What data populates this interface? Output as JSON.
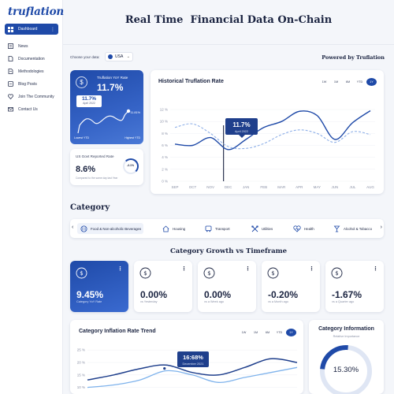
{
  "brand": {
    "logo": "truflation"
  },
  "sidebar": {
    "items": [
      {
        "label": "Dashboard",
        "icon": "dashboard-icon",
        "active": true
      },
      {
        "label": "News",
        "icon": "news-icon"
      },
      {
        "label": "Documentation",
        "icon": "document-icon"
      },
      {
        "label": "Methodologies",
        "icon": "methodology-icon"
      },
      {
        "label": "Blog Posts",
        "icon": "blog-icon"
      },
      {
        "label": "Join The Community",
        "icon": "community-icon"
      },
      {
        "label": "Contact Us",
        "icon": "mail-icon"
      }
    ]
  },
  "header": {
    "title": "Real Time  Financial Data On-Chain"
  },
  "controls": {
    "choose_label": "Choose your data:",
    "country": "USA",
    "powered_by": "Powered by Truflation"
  },
  "truflation_card": {
    "label": "Truflation YoY Rate",
    "value": "11.7%",
    "tooltip_value": "11.7%",
    "tooltip_date": "April 2022",
    "max_value": "11.81%",
    "lowest_label": "Lowest YTD",
    "highest_label": "Highest YTD"
  },
  "govt_card": {
    "label": "US Govt Reported Rate",
    "value": "8.6%",
    "sub": "Compared to the same day last Year",
    "ring_value": "-3.1%"
  },
  "historical": {
    "title": "Historical Truflation Rate",
    "ranges": [
      "1W",
      "1M",
      "6M",
      "YTD",
      "1Y"
    ],
    "active_range": "1Y",
    "tooltip_value": "11.7%",
    "tooltip_date": "April 2022"
  },
  "chart_data": [
    {
      "type": "line",
      "title": "Historical Truflation Rate",
      "x": [
        "SEP",
        "OCT",
        "NOV",
        "DEC",
        "JAN",
        "FEB",
        "MAR",
        "APR",
        "MAY",
        "JUN",
        "JUL",
        "AUG"
      ],
      "yticks": [
        "12 %",
        "10 %",
        "8 %",
        "6 %",
        "4 %",
        "2 %",
        "0 %"
      ],
      "ylim": [
        0,
        12
      ],
      "series": [
        {
          "values": [
            6.2,
            6.0,
            7.3,
            5.3,
            7.0,
            9.0,
            10.0,
            11.7,
            11.0,
            7.0,
            9.8,
            11.8
          ],
          "style": "solid",
          "color": "#1f4aa8"
        },
        {
          "values": [
            9.0,
            9.6,
            8.0,
            5.8,
            5.5,
            6.3,
            7.8,
            8.6,
            8.0,
            6.5,
            8.3,
            7.8
          ],
          "style": "dashed",
          "color": "#8fb0e8"
        }
      ]
    },
    {
      "type": "line",
      "title": "Category Inflation Rate Trend",
      "yticks": [
        "25 %",
        "20 %",
        "15 %",
        "10 %"
      ],
      "ylim": [
        8,
        26
      ],
      "series": [
        {
          "values": [
            13,
            15,
            17.5,
            19,
            16,
            15,
            18,
            21.5,
            20
          ],
          "style": "solid",
          "color": "#1f3f8c"
        },
        {
          "values": [
            10,
            11,
            13,
            16.68,
            15,
            12,
            14,
            16,
            18
          ],
          "style": "solid",
          "color": "#7fb3ec"
        }
      ]
    }
  ],
  "category": {
    "title": "Category",
    "items": [
      {
        "label": "Food & Non-alcoholic Beverages",
        "icon": "food-icon"
      },
      {
        "label": "Housing",
        "icon": "housing-icon"
      },
      {
        "label": "Transport",
        "icon": "transport-icon"
      },
      {
        "label": "Utilities",
        "icon": "utilities-icon"
      },
      {
        "label": "Health",
        "icon": "health-icon"
      },
      {
        "label": "Alcohol & Tobacco",
        "icon": "alcohol-icon"
      }
    ]
  },
  "growth": {
    "title": "Category Growth vs Timeframe",
    "cards": [
      {
        "value": "9.45%",
        "sub": "Category YoY Rate"
      },
      {
        "value": "0.00%",
        "sub": "vs Yesterday"
      },
      {
        "value": "0.00%",
        "sub": "vs a Week ago"
      },
      {
        "value": "-0.20%",
        "sub": "vs a Month ago"
      },
      {
        "value": "-1.67%",
        "sub": "vs a Quarter ago"
      }
    ]
  },
  "trend": {
    "title": "Category Inflation Rate Trend",
    "ranges": [
      "1W",
      "1M",
      "6M",
      "YTD",
      "1Y"
    ],
    "active_range": "1Y",
    "tooltip_value": "16:68%",
    "tooltip_date": "December 2021"
  },
  "info": {
    "title": "Category Information",
    "sub": "Relative Importance",
    "value": "15.30%"
  }
}
